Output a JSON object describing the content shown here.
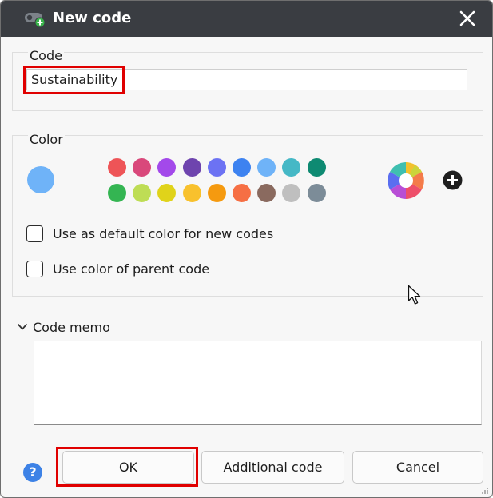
{
  "dialog": {
    "title": "New code",
    "title_icon": "code-add-icon",
    "close_icon": "close-icon"
  },
  "code_section": {
    "label": "Code",
    "value": "Sustainability"
  },
  "color_section": {
    "label": "Color",
    "current_color": "#6fb3f8",
    "palette_row1": [
      "#ee5457",
      "#d9487b",
      "#a349ea",
      "#6e44ae",
      "#6c72f3",
      "#3d82f0",
      "#6fb3f8",
      "#45b8c6",
      "#0e8a72"
    ],
    "palette_row2": [
      "#34b552",
      "#bedd55",
      "#e0d31a",
      "#f8c12d",
      "#f59a0f",
      "#f66f44",
      "#8a6a5f",
      "#bfbfbf",
      "#7c8c98"
    ],
    "wheel_icon": "color-wheel-icon",
    "plus_icon": "plus-circle-icon",
    "default_color_checkbox": {
      "label": "Use as default color for new codes",
      "checked": false
    },
    "parent_color_checkbox": {
      "label": "Use color of parent code",
      "checked": false
    }
  },
  "memo": {
    "label": "Code memo",
    "chevron_icon": "chevron-down-icon",
    "value": ""
  },
  "buttons": {
    "help_label": "?",
    "ok_label": "OK",
    "additional_label": "Additional code",
    "cancel_label": "Cancel"
  },
  "colors": {
    "titlebar": "#3a3d42",
    "highlight": "#e00000",
    "help": "#3d82e6"
  }
}
